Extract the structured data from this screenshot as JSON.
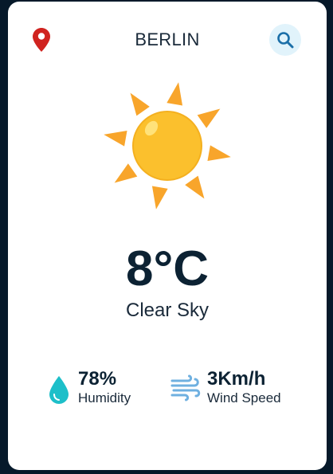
{
  "header": {
    "location_icon": "map-pin-icon",
    "city": "BERLIN",
    "search_icon": "search-icon"
  },
  "weather": {
    "icon": "sun-icon",
    "temperature": "8°C",
    "description": "Clear Sky"
  },
  "stats": {
    "humidity": {
      "icon": "water-drop-icon",
      "value": "78%",
      "label": "Humidity"
    },
    "wind": {
      "icon": "wind-icon",
      "value": "3Km/h",
      "label": "Wind Speed"
    }
  },
  "colors": {
    "background": "#06192a",
    "card": "#ffffff",
    "pin": "#d0231f",
    "sun_core": "#fbc02d",
    "sun_rays": "#f8a52b",
    "search_bg": "#e1f3fb",
    "search_icon": "#1b6fa8",
    "drop": "#1dbfc9",
    "wind": "#6fb0e0",
    "text": "#0c2233"
  }
}
